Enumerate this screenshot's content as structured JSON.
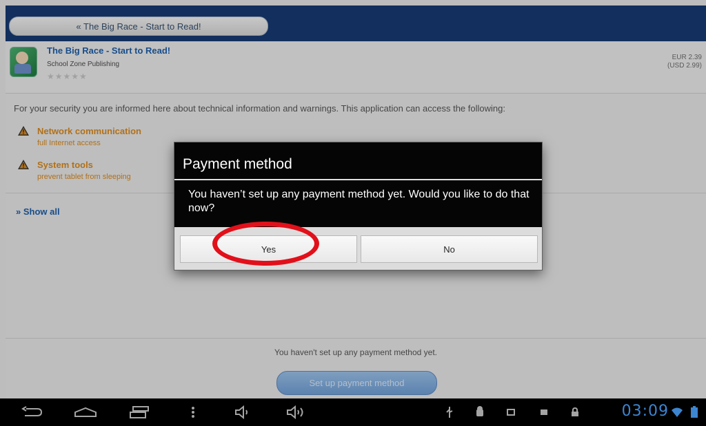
{
  "header": {
    "back_label": "« The Big Race - Start to Read!"
  },
  "app": {
    "title": "The Big Race - Start to Read!",
    "publisher": "School Zone Publishing",
    "rating": "★★★★★",
    "price_eur": "EUR 2.39",
    "price_usd": "(USD 2.99)"
  },
  "security": {
    "intro": "For your security you are informed here about technical information and warnings. This application can access the following:",
    "permissions": [
      {
        "title": "Network communication",
        "subtitle": "full Internet access",
        "icon": "warning-icon"
      },
      {
        "title": "System tools",
        "subtitle": "prevent tablet from sleeping",
        "icon": "warning-icon"
      }
    ],
    "show_all": "» Show all"
  },
  "footer": {
    "message": "You haven't set up any payment method yet.",
    "setup_button": "Set up payment method"
  },
  "dialog": {
    "title": "Payment method",
    "body": "You haven’t set up any payment method yet. Would you like to do that now?",
    "yes": "Yes",
    "no": "No"
  },
  "navbar": {
    "icons": [
      "back-icon",
      "home-icon",
      "recent-apps-icon",
      "menu-icon",
      "volume-down-icon",
      "volume-up-icon",
      "usb-icon",
      "android-debug-icon",
      "notification-icon-1",
      "notification-icon-2",
      "lock-icon",
      "wifi-icon",
      "battery-icon"
    ],
    "time": "03:09"
  },
  "colors": {
    "top_bar": "#173a72",
    "link_blue": "#1e5ea8",
    "warning_orange": "#d8891f",
    "clock_blue": "#4aa3ff",
    "highlight_red": "#e1101a"
  }
}
